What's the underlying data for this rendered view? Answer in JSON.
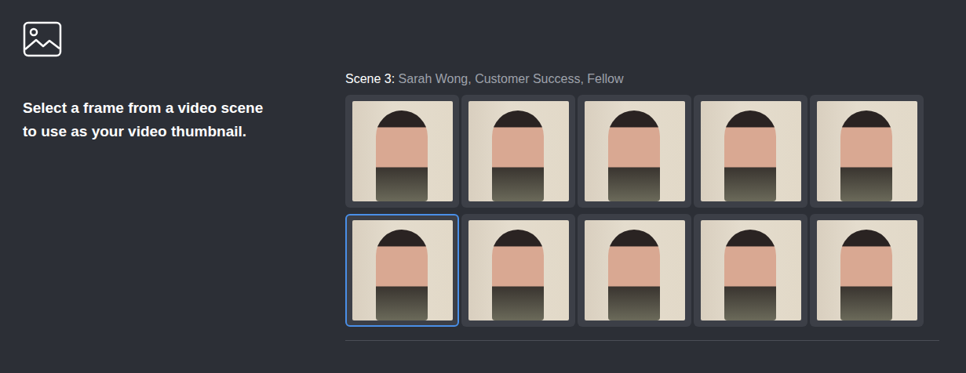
{
  "heading_lines": [
    "Select a frame from a video scene",
    "to use as your video thumbnail."
  ],
  "scene": {
    "label": "Scene 3:",
    "title": "Sarah Wong, Customer Success, Fellow"
  },
  "frames": [
    {
      "selected": false
    },
    {
      "selected": false
    },
    {
      "selected": false
    },
    {
      "selected": false
    },
    {
      "selected": false
    },
    {
      "selected": true
    },
    {
      "selected": false
    },
    {
      "selected": false
    },
    {
      "selected": false
    },
    {
      "selected": false
    }
  ]
}
